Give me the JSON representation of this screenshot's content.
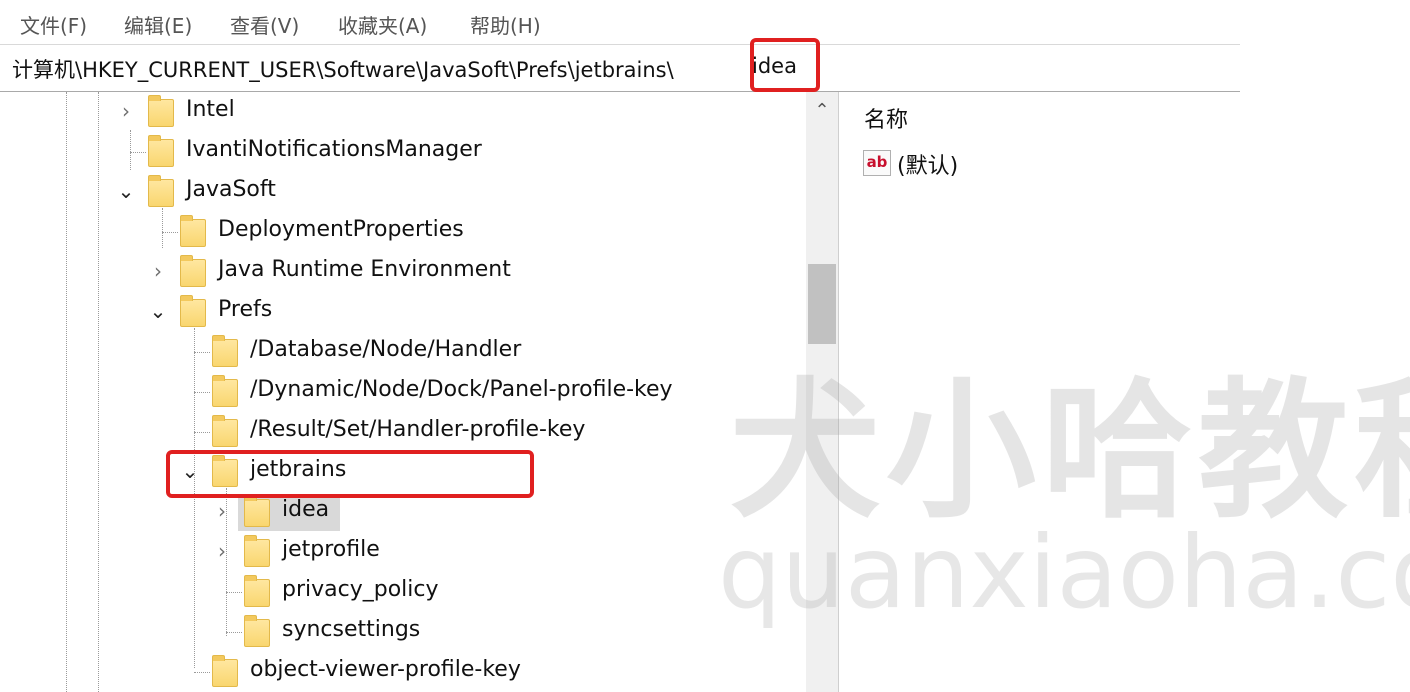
{
  "menu": {
    "items": [
      {
        "label": "文件(F)"
      },
      {
        "label": "编辑(E)"
      },
      {
        "label": "查看(V)"
      },
      {
        "label": "收藏夹(A)"
      },
      {
        "label": "帮助(H)"
      }
    ]
  },
  "address": {
    "path": "计算机\\HKEY_CURRENT_USER\\Software\\JavaSoft\\Prefs\\jetbrains\\",
    "last_segment": "idea",
    "highlight_color": "#e02020"
  },
  "tree": {
    "nodes": [
      {
        "label": "Intel",
        "expander": "›"
      },
      {
        "label": "IvantiNotificationsManager",
        "expander": ""
      },
      {
        "label": "JavaSoft",
        "expander": "⌄"
      },
      {
        "label": "DeploymentProperties",
        "expander": ""
      },
      {
        "label": "Java Runtime Environment",
        "expander": "›"
      },
      {
        "label": "Prefs",
        "expander": "⌄"
      },
      {
        "label": "/Database/Node/Handler",
        "expander": ""
      },
      {
        "label": "/Dynamic/Node/Dock/Panel-profile-key",
        "expander": ""
      },
      {
        "label": "/Result/Set/Handler-profile-key",
        "expander": ""
      },
      {
        "label": "jetbrains",
        "expander": "⌄"
      },
      {
        "label": "idea",
        "expander": "›",
        "selected": true
      },
      {
        "label": "jetprofile",
        "expander": "›"
      },
      {
        "label": "privacy_policy",
        "expander": ""
      },
      {
        "label": "syncsettings",
        "expander": ""
      },
      {
        "label": "object-viewer-profile-key",
        "expander": ""
      }
    ]
  },
  "scrollbar": {
    "up_arrow": "⌃"
  },
  "values_pane": {
    "column_header": "名称",
    "icon_text": "ab",
    "entries": [
      {
        "name": "(默认)"
      }
    ]
  },
  "watermark": {
    "chinese": "犬小哈教程",
    "url": "quanxiaoha.com"
  }
}
